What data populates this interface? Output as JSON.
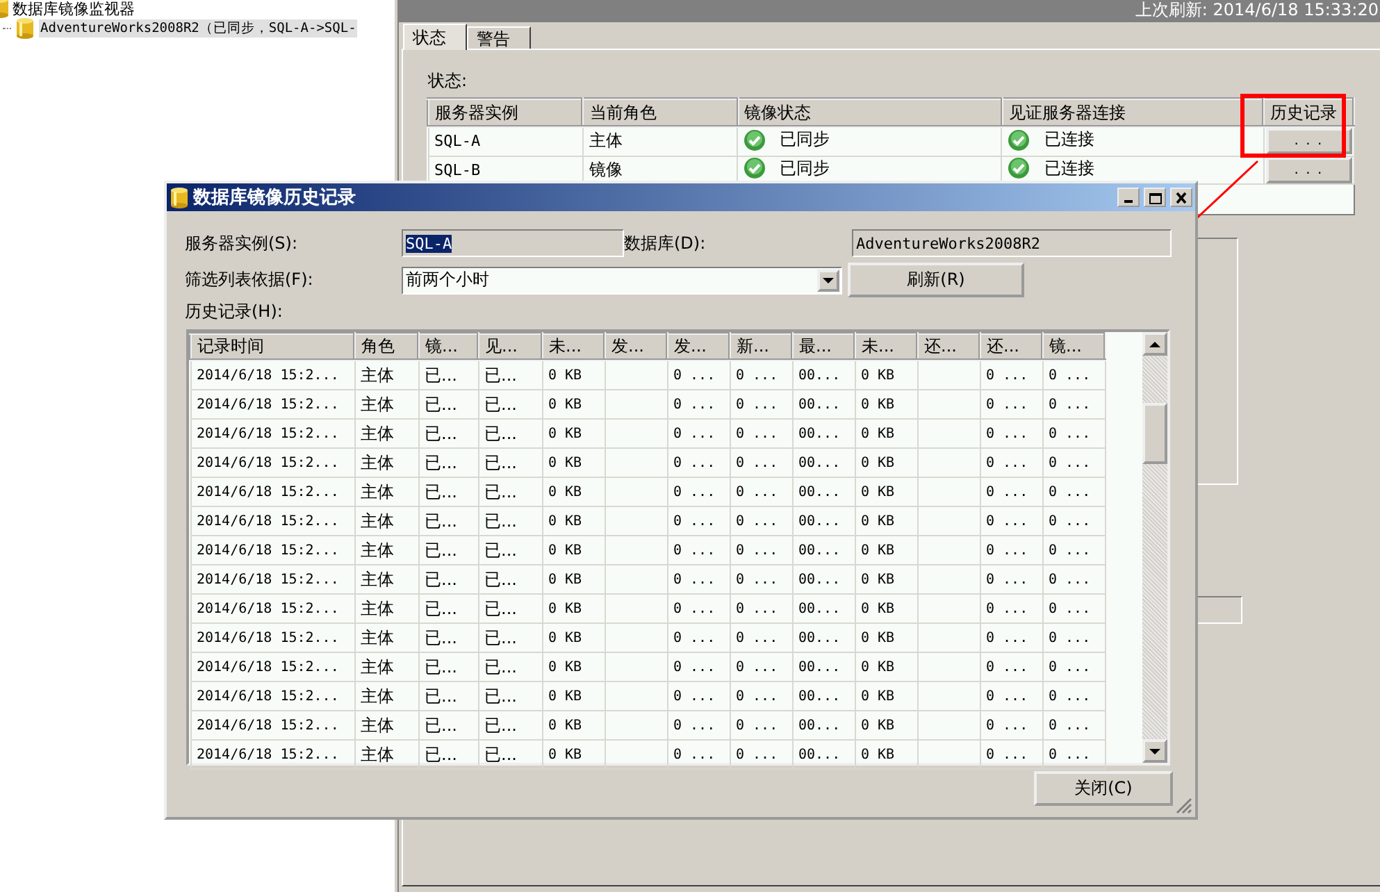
{
  "header": {
    "last_refresh": "上次刷新: 2014/6/18 15:33:20"
  },
  "tree": {
    "root": "数据库镜像监视器",
    "children": [
      {
        "label": "AdventureWorks2008R2（已同步，SQL-A->SQL-",
        "selected": true
      }
    ]
  },
  "tabs": [
    {
      "label": "状态",
      "selected": true
    },
    {
      "label": "警告",
      "selected": false
    }
  ],
  "status": {
    "label": "状态:",
    "columns": [
      "服务器实例",
      "当前角色",
      "镜像状态",
      "见证服务器连接",
      "历史记录"
    ],
    "rows": [
      {
        "server": "SQL-A",
        "role": "主体",
        "mirror_state": "已同步",
        "witness": "已连接",
        "history_button": ". . ."
      },
      {
        "server": "SQL-B",
        "role": "镜像",
        "mirror_state": "已同步",
        "witness": "已连接",
        "history_button": ". . ."
      }
    ]
  },
  "dialog": {
    "title": "数据库镜像历史记录",
    "server_label": "服务器实例(S):",
    "server_value": "SQL-A",
    "database_label": "数据库(D):",
    "database_value": "AdventureWorks2008R2",
    "filter_label": "筛选列表依据(F):",
    "filter_value": "前两个小时",
    "refresh_button": "刷新(R)",
    "history_label": "历史记录(H):",
    "columns": [
      "记录时间",
      "角色",
      "镜...",
      "见...",
      "未...",
      "发...",
      "发...",
      "新...",
      "最...",
      "未...",
      "还...",
      "还...",
      "镜..."
    ],
    "rows": [
      [
        "2014/6/18 15:2...",
        "主体",
        "已...",
        "已...",
        "0 KB",
        "",
        "0 ...",
        "0 ...",
        "00...",
        "0 KB",
        "",
        "0 ...",
        "0 ..."
      ],
      [
        "2014/6/18 15:2...",
        "主体",
        "已...",
        "已...",
        "0 KB",
        "",
        "0 ...",
        "0 ...",
        "00...",
        "0 KB",
        "",
        "0 ...",
        "0 ..."
      ],
      [
        "2014/6/18 15:2...",
        "主体",
        "已...",
        "已...",
        "0 KB",
        "",
        "0 ...",
        "0 ...",
        "00...",
        "0 KB",
        "",
        "0 ...",
        "0 ..."
      ],
      [
        "2014/6/18 15:2...",
        "主体",
        "已...",
        "已...",
        "0 KB",
        "",
        "0 ...",
        "0 ...",
        "00...",
        "0 KB",
        "",
        "0 ...",
        "0 ..."
      ],
      [
        "2014/6/18 15:2...",
        "主体",
        "已...",
        "已...",
        "0 KB",
        "",
        "0 ...",
        "0 ...",
        "00...",
        "0 KB",
        "",
        "0 ...",
        "0 ..."
      ],
      [
        "2014/6/18 15:2...",
        "主体",
        "已...",
        "已...",
        "0 KB",
        "",
        "0 ...",
        "0 ...",
        "00...",
        "0 KB",
        "",
        "0 ...",
        "0 ..."
      ],
      [
        "2014/6/18 15:2...",
        "主体",
        "已...",
        "已...",
        "0 KB",
        "",
        "0 ...",
        "0 ...",
        "00...",
        "0 KB",
        "",
        "0 ...",
        "0 ..."
      ],
      [
        "2014/6/18 15:2...",
        "主体",
        "已...",
        "已...",
        "0 KB",
        "",
        "0 ...",
        "0 ...",
        "00...",
        "0 KB",
        "",
        "0 ...",
        "0 ..."
      ],
      [
        "2014/6/18 15:2...",
        "主体",
        "已...",
        "已...",
        "0 KB",
        "",
        "0 ...",
        "0 ...",
        "00...",
        "0 KB",
        "",
        "0 ...",
        "0 ..."
      ],
      [
        "2014/6/18 15:2...",
        "主体",
        "已...",
        "已...",
        "0 KB",
        "",
        "0 ...",
        "0 ...",
        "00...",
        "0 KB",
        "",
        "0 ...",
        "0 ..."
      ],
      [
        "2014/6/18 15:2...",
        "主体",
        "已...",
        "已...",
        "0 KB",
        "",
        "0 ...",
        "0 ...",
        "00...",
        "0 KB",
        "",
        "0 ...",
        "0 ..."
      ],
      [
        "2014/6/18 15:2...",
        "主体",
        "已...",
        "已...",
        "0 KB",
        "",
        "0 ...",
        "0 ...",
        "00...",
        "0 KB",
        "",
        "0 ...",
        "0 ..."
      ],
      [
        "2014/6/18 15:2...",
        "主体",
        "已...",
        "已...",
        "0 KB",
        "",
        "0 ...",
        "0 ...",
        "00...",
        "0 KB",
        "",
        "0 ...",
        "0 ..."
      ],
      [
        "2014/6/18 15:2...",
        "主体",
        "已...",
        "已...",
        "0 KB",
        "",
        "0 ...",
        "0 ...",
        "00...",
        "0 KB",
        "",
        "0 ...",
        "0 ..."
      ]
    ],
    "close_button": "关闭(C)"
  }
}
